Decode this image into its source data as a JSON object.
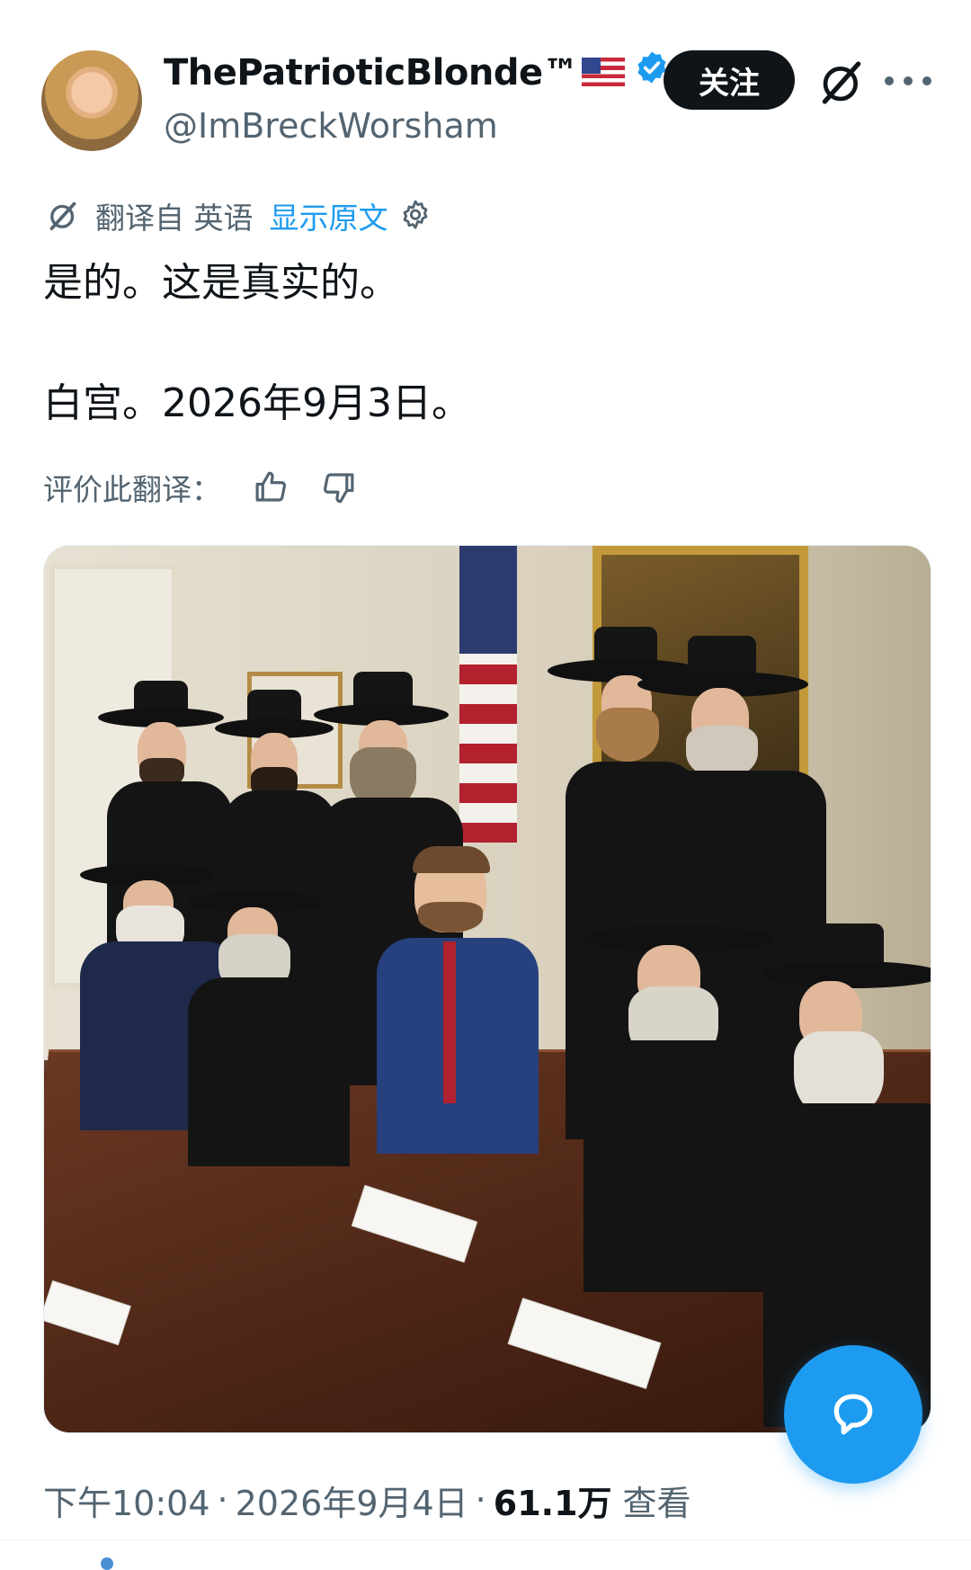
{
  "author": {
    "display_name": "ThePatrioticBlonde™",
    "handle": "@ImBreckWorsham",
    "avatar_icon": "profile-photo",
    "verified_color": "#1d9bf0"
  },
  "header": {
    "follow_label": "关注",
    "grok_icon": "grok-icon",
    "more_icon": "more-icon"
  },
  "translation": {
    "source_label": "翻译自 英语",
    "show_original": "显示原文",
    "rate_label": "评价此翻译："
  },
  "tweet": {
    "line1": "是的。这是真实的。",
    "line2": "白宫。2026年9月3日。"
  },
  "meta": {
    "time": "下午10:04",
    "separator": "·",
    "date": "2026年9月4日",
    "views_count": "61.1万",
    "views_label": "查看"
  },
  "colors": {
    "accent": "#1d9bf0",
    "text": "#0f1419",
    "secondary": "#536471"
  }
}
